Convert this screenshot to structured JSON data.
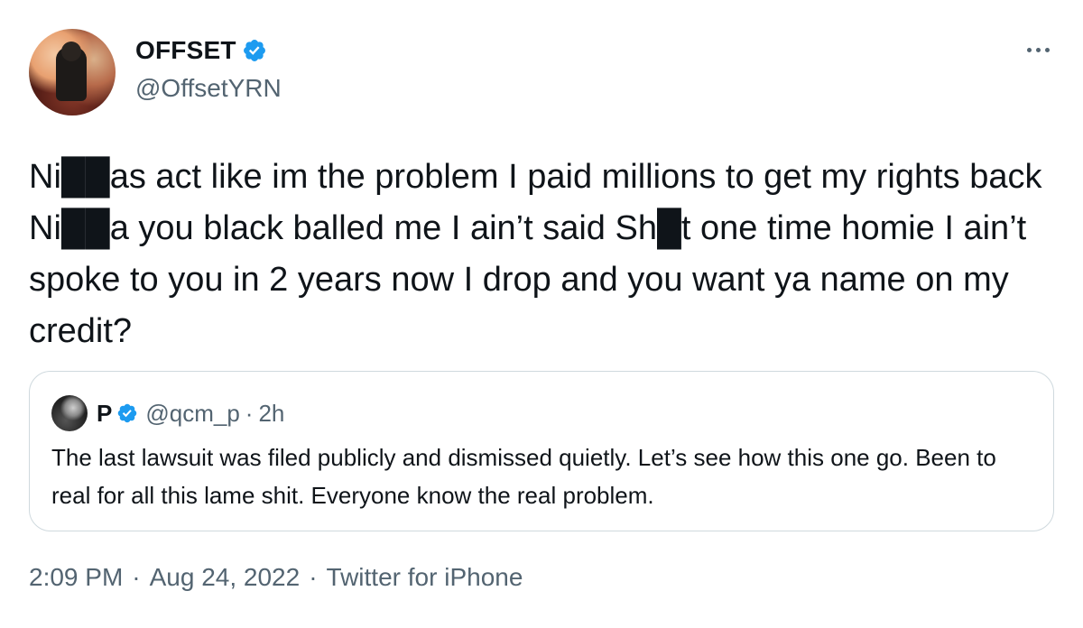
{
  "author": {
    "name": "OFFSET",
    "handle": "@OffsetYRN",
    "verified": true
  },
  "tweet": {
    "text": "Ni██as act like im the problem I paid millions to get my rights back  Ni██a you black balled me I ain’t said Sh█t one time homie I ain’t spoke to you in 2 years now I drop and you want ya name on my credit?"
  },
  "quoted_tweet": {
    "name": "P",
    "handle": "@qcm_p",
    "separator": "·",
    "time": "2h",
    "text": "The last lawsuit was filed publicly and dismissed quietly. Let’s see how this one go. Been to real for all this lame shit. Everyone know the real problem."
  },
  "meta": {
    "time": "2:09 PM",
    "date": "Aug 24, 2022",
    "source": "Twitter for iPhone",
    "separator": "·"
  },
  "icons": {
    "verified": "verified-badge-icon",
    "more": "more-options-icon"
  },
  "colors": {
    "verified": "#1d9bf0",
    "text": "#0f1419",
    "secondary": "#536471",
    "border": "#cfd9de"
  }
}
